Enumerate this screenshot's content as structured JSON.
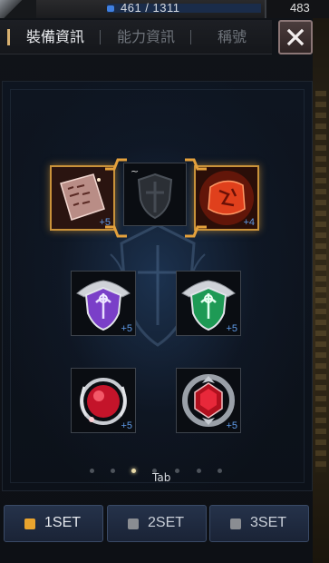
{
  "status": {
    "mp_text": "461 / 1311",
    "level_text": "483"
  },
  "tabs": [
    {
      "label": "裝備資訊",
      "active": true
    },
    {
      "label": "能力資訊",
      "active": false
    },
    {
      "label": "稱號",
      "active": false
    }
  ],
  "slots": {
    "top_left": {
      "icon": "rune-tablet-icon",
      "enhance": "+5"
    },
    "top_center": {
      "icon": "shield-placeholder-icon",
      "mark": "~"
    },
    "top_right": {
      "icon": "red-rune-stone-icon",
      "enhance": "+4"
    },
    "mid_left": {
      "icon": "purple-emblem-icon",
      "enhance": "+5"
    },
    "mid_right": {
      "icon": "green-emblem-icon",
      "enhance": "+5"
    },
    "bottom_left": {
      "icon": "red-orb-amulet-icon",
      "enhance": "+5"
    },
    "bottom_right": {
      "icon": "red-gem-ring-icon",
      "enhance": "+5"
    }
  },
  "pager": {
    "count": 7,
    "active_index": 2,
    "hint": "Tab"
  },
  "sets": [
    {
      "label": "1SET",
      "active": true
    },
    {
      "label": "2SET",
      "active": false
    },
    {
      "label": "3SET",
      "active": false
    }
  ],
  "colors": {
    "gold_frame": "#c9923a",
    "enhance_blue": "#5f9be8",
    "active_set": "#e9a42e"
  }
}
